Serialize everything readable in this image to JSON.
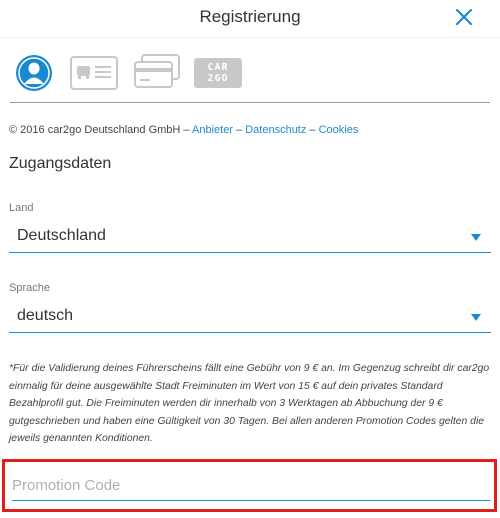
{
  "header": {
    "title": "Registrierung",
    "close_icon": "close-icon",
    "accent": "#1a8ad0"
  },
  "steps": [
    {
      "icon": "person-icon",
      "active": true
    },
    {
      "icon": "id-card-icon",
      "active": false
    },
    {
      "icon": "credit-card-icon",
      "active": false
    },
    {
      "icon": "car2go-logo-icon",
      "active": false,
      "line1": "CAR",
      "line2": "2GO"
    }
  ],
  "copyright": {
    "text": "© 2016 car2go Deutschland GmbH",
    "sep1": " – ",
    "link_anbieter": "Anbieter",
    "sep2": " – ",
    "link_datenschutz": "Datenschutz",
    "sep3": " – ",
    "link_cookies": "Cookies"
  },
  "section": {
    "title": "Zugangsdaten"
  },
  "land": {
    "label": "Land",
    "value": "Deutschland"
  },
  "sprache": {
    "label": "Sprache",
    "value": "deutsch"
  },
  "disclaimer": "*Für die Validierung deines Führerscheins fällt eine Gebühr von 9 € an. Im Gegenzug schreibt dir car2go einmalig für deine ausgewählte Stadt Freiminuten im Wert von 15 € auf dein privates Standard Bezahlprofil gut. Die Freiminuten werden dir innerhalb von 3 Werktagen ab Abbuchung der 9 € gutgeschrieben und haben eine Gültigkeit von 30 Tagen. Bei allen anderen Promotion Codes gelten die jeweils genannten Konditionen.",
  "promo": {
    "placeholder": "Promotion Code",
    "value": "",
    "highlight_color": "#e31b1b"
  }
}
